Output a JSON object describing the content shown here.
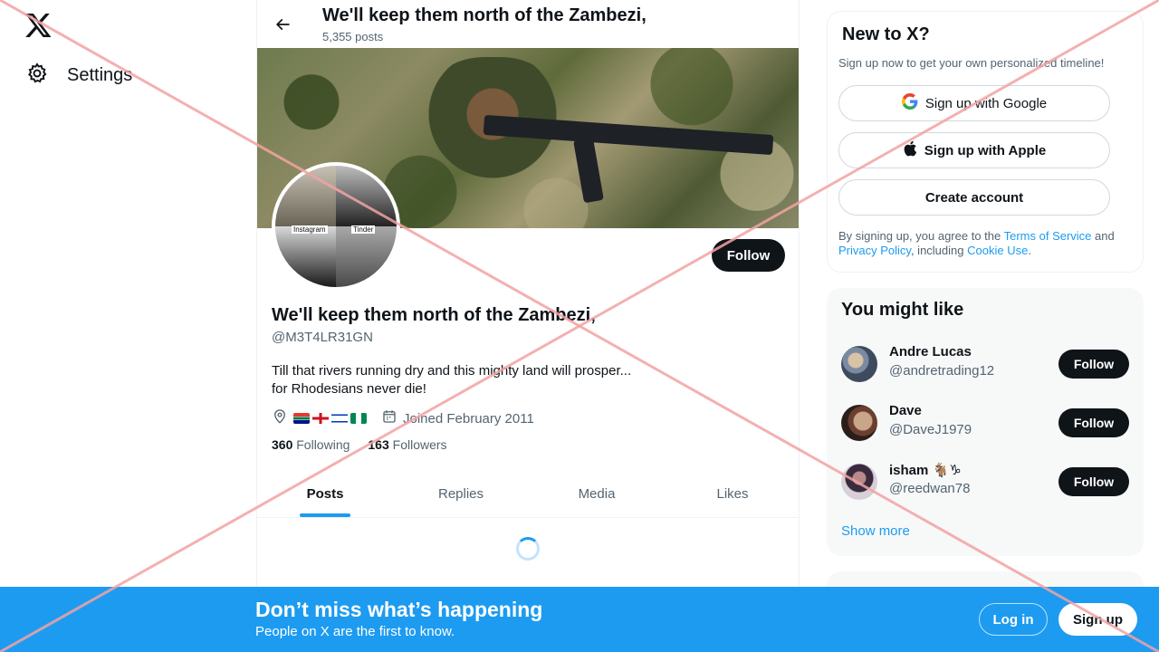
{
  "nav": {
    "logo_icon": "x-logo-icon",
    "settings_label": "Settings"
  },
  "header": {
    "title": "We'll keep them north of the Zambezi,",
    "posts_count": "5,355 posts"
  },
  "avatar": {
    "caption_left": "Instagram",
    "caption_right": "Tinder"
  },
  "profile": {
    "follow_label": "Follow",
    "name": "We'll keep them north of the Zambezi,",
    "handle": "@M3T4LR31GN",
    "bio_line1": "Till that rivers running dry and this mighty land will prosper...",
    "bio_line2": "for Rhodesians never die!",
    "joined": "Joined February 2011",
    "following_count": "360",
    "following_label": "Following",
    "followers_count": "163",
    "followers_label": "Followers"
  },
  "tabs": [
    {
      "label": "Posts",
      "active": true
    },
    {
      "label": "Replies",
      "active": false
    },
    {
      "label": "Media",
      "active": false
    },
    {
      "label": "Likes",
      "active": false
    }
  ],
  "new_to_x": {
    "title": "New to X?",
    "subtitle": "Sign up now to get your own personalized timeline!",
    "google_label": "Sign up with Google",
    "apple_label": "Sign up with Apple",
    "create_label": "Create account",
    "legal_prefix": "By signing up, you agree to the ",
    "terms": "Terms of Service",
    "and": " and ",
    "privacy": "Privacy Policy",
    "including": ", including ",
    "cookie": "Cookie Use",
    "period": "."
  },
  "you_might_like": {
    "title": "You might like",
    "users": [
      {
        "name": "Andre Lucas",
        "handle": "@andretrading12",
        "follow": "Follow"
      },
      {
        "name": "Dave",
        "handle": "@DaveJ1979",
        "follow": "Follow"
      },
      {
        "name": "isham 🐐♑",
        "handle": "@reedwan78",
        "follow": "Follow"
      }
    ],
    "show_more": "Show more"
  },
  "bottom_bar": {
    "title": "Don’t miss what’s happening",
    "subtitle": "People on X are the first to know.",
    "login": "Log in",
    "signup": "Sign up"
  },
  "colors": {
    "accent": "#1d9bf0",
    "text": "#0f1419",
    "muted": "#536471",
    "strike": "#f3a3a3"
  }
}
